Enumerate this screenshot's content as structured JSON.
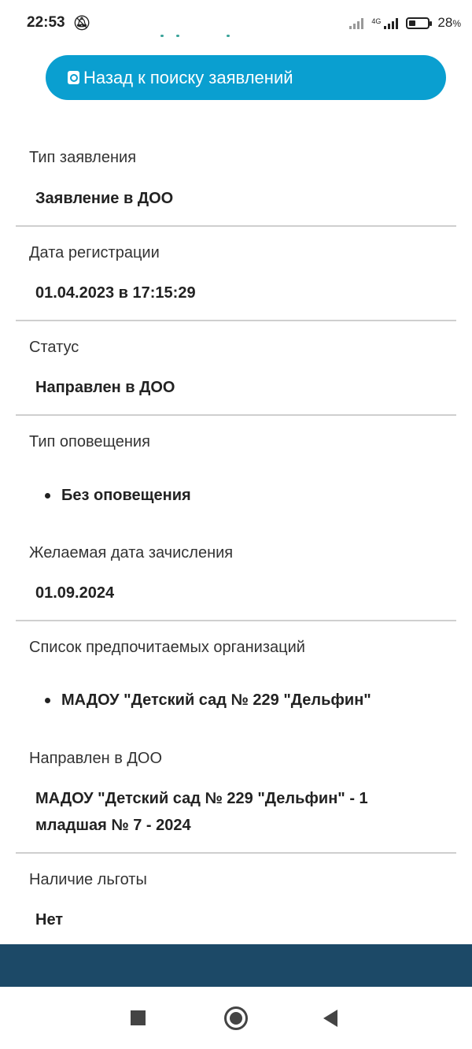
{
  "status_bar": {
    "time": "22:53",
    "network": "4G",
    "battery": "28",
    "battery_unit": "%"
  },
  "back_button": {
    "label": "Назад к поиску заявлений",
    "icon": "search-document-icon"
  },
  "fields": [
    {
      "label": "Тип заявления",
      "value": "Заявление в ДОО"
    },
    {
      "label": "Дата регистрации",
      "value": "01.04.2023 в 17:15:29"
    },
    {
      "label": "Статус",
      "value": "Направлен в ДОО"
    },
    {
      "label": "Тип оповещения",
      "items": [
        "Без оповещения"
      ]
    },
    {
      "label": "Желаемая дата зачисления",
      "value": "01.09.2024"
    },
    {
      "label": "Список предпочитаемых организаций",
      "items": [
        "МАДОУ \"Детский сад № 229 \"Дельфин\""
      ]
    },
    {
      "label": "Направлен в ДОО",
      "value": "МАДОУ \"Детский сад № 229 \"Дельфин\" - 1 младшая № 7 - 2024"
    },
    {
      "label": "Наличие льготы",
      "value": "Нет"
    }
  ],
  "colors": {
    "accent": "#0a9fd0",
    "footer": "#1c4967",
    "divider": "#cfcfcf"
  },
  "nav": {
    "recent": "square-recents-icon",
    "home": "circle-home-icon",
    "back": "triangle-back-icon"
  }
}
